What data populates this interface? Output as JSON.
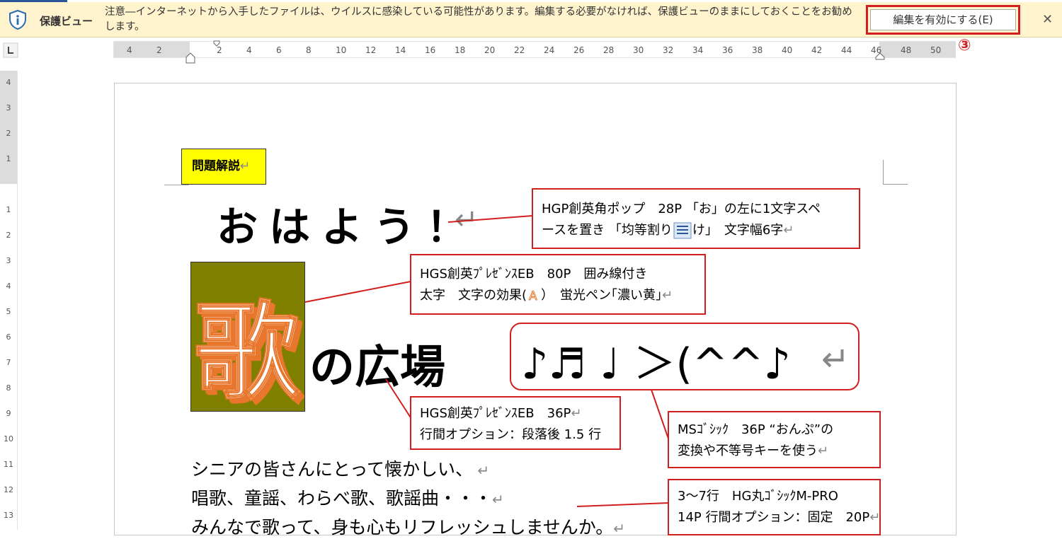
{
  "protected_view": {
    "title": "保護ビュー",
    "message": "注意―インターネットから入手したファイルは、ウイルスに感染している可能性があります。編集する必要がなければ、保護ビューのままにしておくことをお勧めします。",
    "enable_button": "編集を有効にする(E)",
    "close_symbol": "✕",
    "step_marker": "③",
    "icon": "shield-info-icon"
  },
  "ruler": {
    "horizontal_numbers": [
      "4",
      "2",
      "2",
      "4",
      "6",
      "8",
      "10",
      "12",
      "14",
      "16",
      "18",
      "20",
      "22",
      "24",
      "26",
      "28",
      "30",
      "32",
      "34",
      "36",
      "38",
      "40",
      "42",
      "44",
      "46",
      "48",
      "50"
    ],
    "vertical_numbers": [
      "4",
      "3",
      "2",
      "1",
      "1",
      "2",
      "3",
      "4",
      "5",
      "6",
      "7",
      "8",
      "9",
      "10",
      "11",
      "12",
      "13"
    ]
  },
  "document": {
    "label": "問題解説",
    "paragraph_mark": "↵",
    "greeting": "おはよう！",
    "title_char": "歌",
    "title_rest": "の広場",
    "notes_line": "♪♬ ♩ ＞(^^♪",
    "body_lines": [
      "シニアの皆さんにとって懐かしい、",
      "唱歌、童謡、わらべ歌、歌謡曲・・・",
      "みんなで歌って、身も心もリフレッシュしませんか。"
    ]
  },
  "callouts": {
    "greeting_note_1": "HGP創英角ポップ　28P 「お」の左に1文字スペ",
    "greeting_note_2a": "ースを置き 「均等割り",
    "greeting_note_2b": "け」　文字幅6字",
    "uta_note_1": "HGS創英ﾌﾟﾚｾﾞﾝｽEB　80P　囲み線付き",
    "uta_note_2a": "太字　文字の効果(",
    "uta_note_2b": "）　蛍光ペン｢濃い黄｣",
    "hiroba_note_1": "HGS創英ﾌﾟﾚｾﾞﾝｽEB　36P",
    "hiroba_note_2": "行間オプション：段落後 1.5 行",
    "notes_note_1": "MSｺﾞｼｯｸ　36P “おんぷ”の",
    "notes_note_2": "変換や不等号キーを使う",
    "body_note_1": "3～7行　HG丸ｺﾞｼｯｸM-PRO",
    "body_note_2": "14P 行間オプション：固定　20P"
  },
  "colors": {
    "accent_red": "#d11f1f",
    "info_bar": "#fff4ce",
    "label_yellow": "#ffff00",
    "uta_background": "#808000",
    "uta_effect_orange": "#e8762c"
  }
}
